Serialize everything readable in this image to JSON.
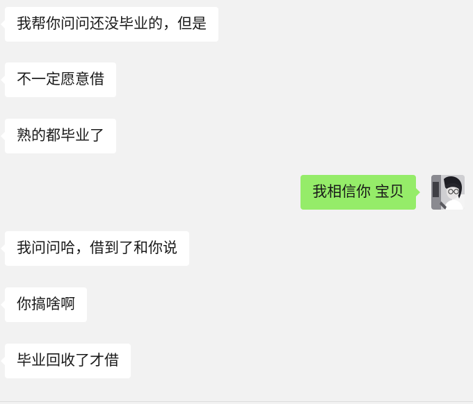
{
  "colors": {
    "background": "#f2f2f2",
    "incoming_bubble": "#ffffff",
    "outgoing_bubble": "#95ec69",
    "text": "#191919"
  },
  "messages": [
    {
      "side": "incoming",
      "text": "我帮你问问还没毕业的，但是"
    },
    {
      "side": "incoming",
      "text": "不一定愿意借"
    },
    {
      "side": "incoming",
      "text": "熟的都毕业了"
    },
    {
      "side": "outgoing",
      "text": "我相信你 宝贝"
    },
    {
      "side": "incoming",
      "text": "我问问哈，借到了和你说"
    },
    {
      "side": "incoming",
      "text": "你搞啥啊"
    },
    {
      "side": "incoming",
      "text": "毕业回收了才借"
    }
  ]
}
